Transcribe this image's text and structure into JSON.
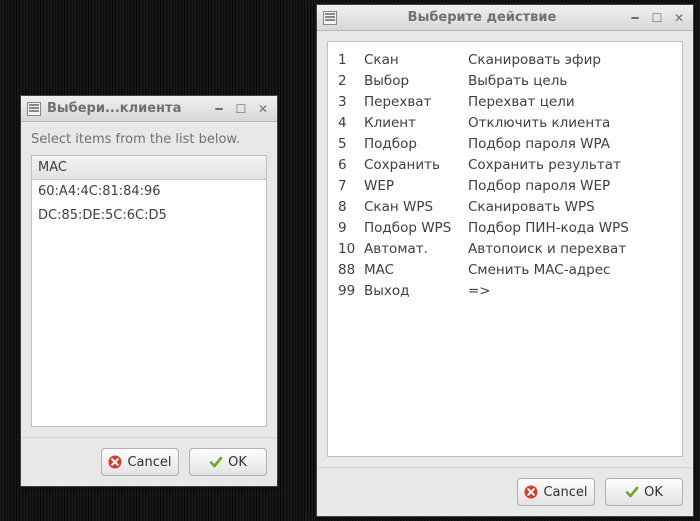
{
  "left_window": {
    "title": "Выбери...клиента",
    "instruction": "Select items from the list below.",
    "list_header": "MAC",
    "items": [
      "60:A4:4C:81:84:96",
      "DC:85:DE:5C:6C:D5"
    ],
    "cancel_label": "Cancel",
    "ok_label": "OK"
  },
  "right_window": {
    "title": "Выберите действие",
    "actions": [
      {
        "num": "1",
        "name": "Скан",
        "desc": "Сканировать эфир"
      },
      {
        "num": "2",
        "name": "Выбор",
        "desc": "Выбрать цель"
      },
      {
        "num": "3",
        "name": "Перехват",
        "desc": "Перехват цели"
      },
      {
        "num": "4",
        "name": "Клиент",
        "desc": "Отключить клиента"
      },
      {
        "num": "5",
        "name": "Подбор",
        "desc": "Подбор пароля WPA"
      },
      {
        "num": "6",
        "name": "Сохранить",
        "desc": "Сохранить результат"
      },
      {
        "num": "7",
        "name": "WEP",
        "desc": "Подбор пароля WEP"
      },
      {
        "num": "8",
        "name": "Скан WPS",
        "desc": "Сканировать WPS"
      },
      {
        "num": "9",
        "name": "Подбор WPS",
        "desc": "Подбор ПИН-кода WPS"
      },
      {
        "num": "10",
        "name": "Автомат.",
        "desc": "Автопоиск и перехват"
      },
      {
        "num": "88",
        "name": "MAC",
        "desc": "Сменить MAC-адрес"
      },
      {
        "num": "99",
        "name": "Выход",
        "desc": "=>"
      }
    ],
    "cancel_label": "Cancel",
    "ok_label": "OK"
  }
}
